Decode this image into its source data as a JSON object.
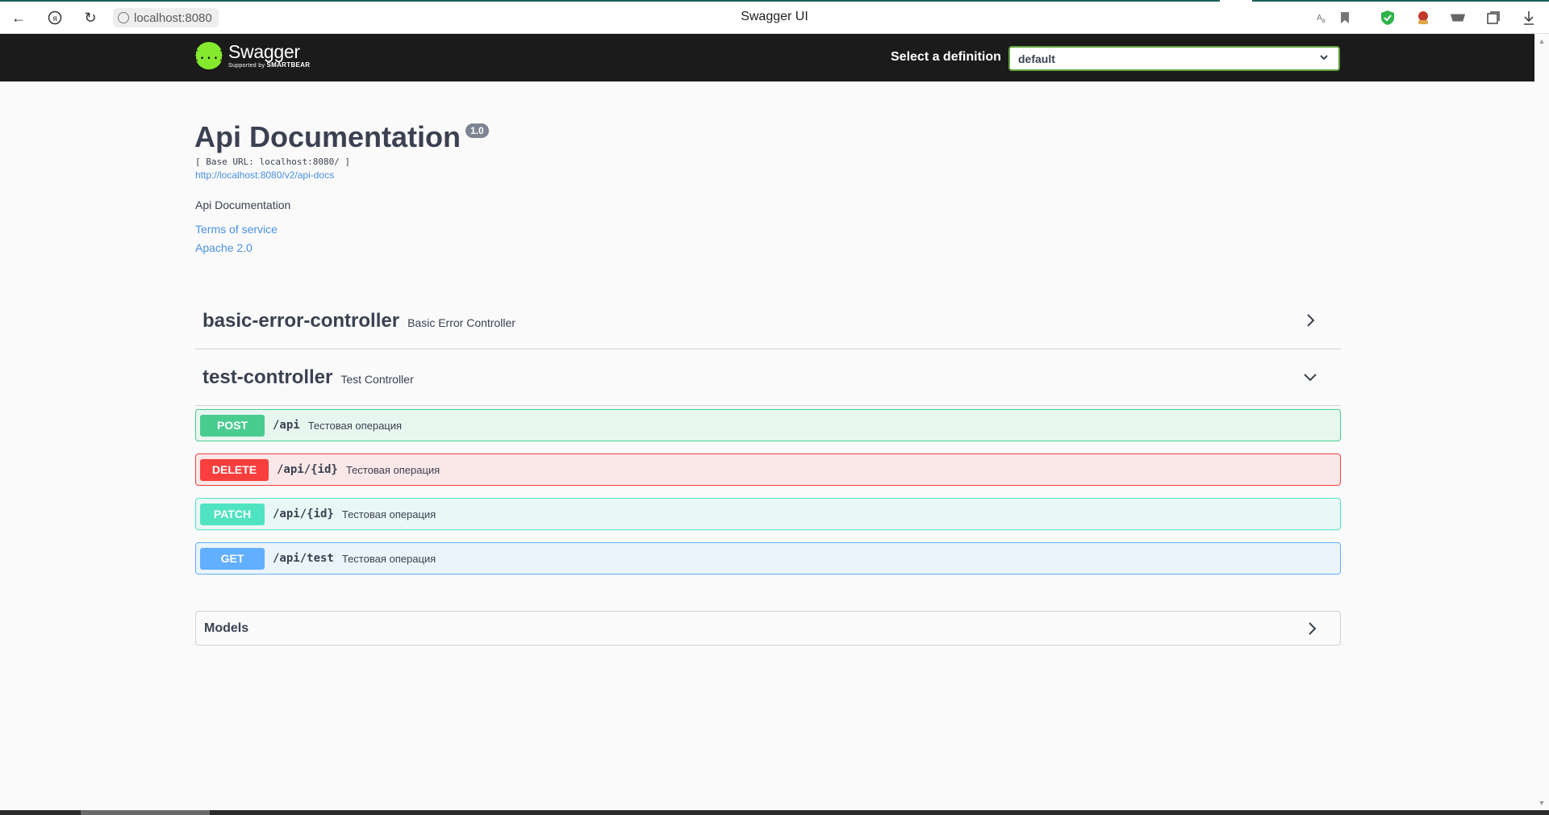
{
  "browser": {
    "url": "localhost:8080",
    "window_title": "Swagger UI",
    "icons": [
      "back-icon",
      "yandex-icon",
      "reload-icon",
      "translate-icon",
      "bookmark-icon",
      "shield-icon",
      "extension-icon",
      "vpn-icon",
      "collections-icon",
      "download-icon"
    ]
  },
  "topbar": {
    "logo_word": "Swagger",
    "logo_sub_prefix": "Supported by",
    "logo_sub_brand": "SMARTBEAR",
    "logo_glyph": "{...}",
    "definition_label": "Select a definition",
    "definition_value": "default"
  },
  "info": {
    "title": "Api Documentation",
    "version": "1.0",
    "base_url": "[ Base URL: localhost:8080/ ]",
    "docs_url": "http://localhost:8080/v2/api-docs",
    "description": "Api Documentation",
    "terms_of_service": "Terms of service",
    "license": "Apache 2.0"
  },
  "tags": [
    {
      "name": "basic-error-controller",
      "description": "Basic Error Controller",
      "expanded": false
    },
    {
      "name": "test-controller",
      "description": "Test Controller",
      "expanded": true
    }
  ],
  "operations": [
    {
      "method": "POST",
      "path": "/api",
      "summary": "Тестовая операция",
      "color": "#49cc90"
    },
    {
      "method": "DELETE",
      "path": "/api/{id}",
      "summary": "Тестовая операция",
      "color": "#f93e3e"
    },
    {
      "method": "PATCH",
      "path": "/api/{id}",
      "summary": "Тестовая операция",
      "color": "#50e3c2"
    },
    {
      "method": "GET",
      "path": "/api/test",
      "summary": "Тестовая операция",
      "color": "#61affe"
    }
  ],
  "models": {
    "title": "Models"
  },
  "colors": {
    "topbar_bg": "#1b1b1b",
    "logo_green": "#85ea2d",
    "link": "#4990e2",
    "text": "#3b4151"
  }
}
